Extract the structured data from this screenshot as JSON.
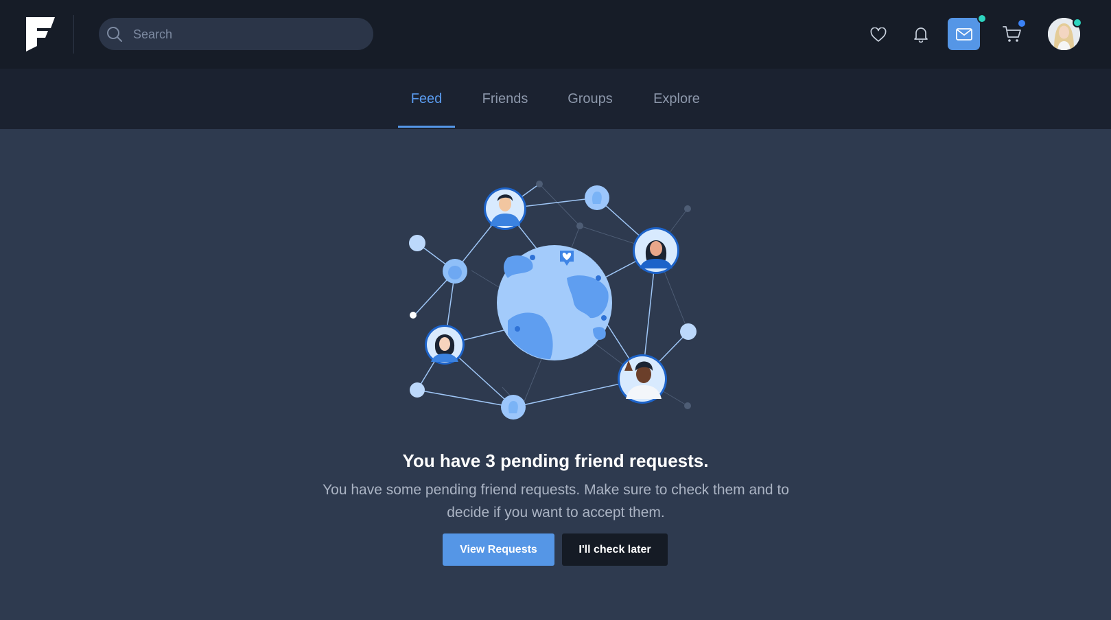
{
  "header": {
    "logo": "F",
    "search": {
      "placeholder": "Search",
      "value": ""
    },
    "icons": [
      "heart-icon",
      "bell-icon",
      "mail-icon",
      "cart-icon"
    ],
    "colors": {
      "accent": "#5596e6",
      "online": "#2dd4bf",
      "cart_badge": "#3b82f6"
    }
  },
  "nav": {
    "tabs": [
      {
        "label": "Feed",
        "active": true
      },
      {
        "label": "Friends",
        "active": false
      },
      {
        "label": "Groups",
        "active": false
      },
      {
        "label": "Explore",
        "active": false
      }
    ]
  },
  "main": {
    "headline": "You have 3 pending friend requests.",
    "description": "You have some pending friend requests. Make sure to check them and to decide if you want to accept them.",
    "primary_button": "View Requests",
    "secondary_button": "I'll check later"
  }
}
